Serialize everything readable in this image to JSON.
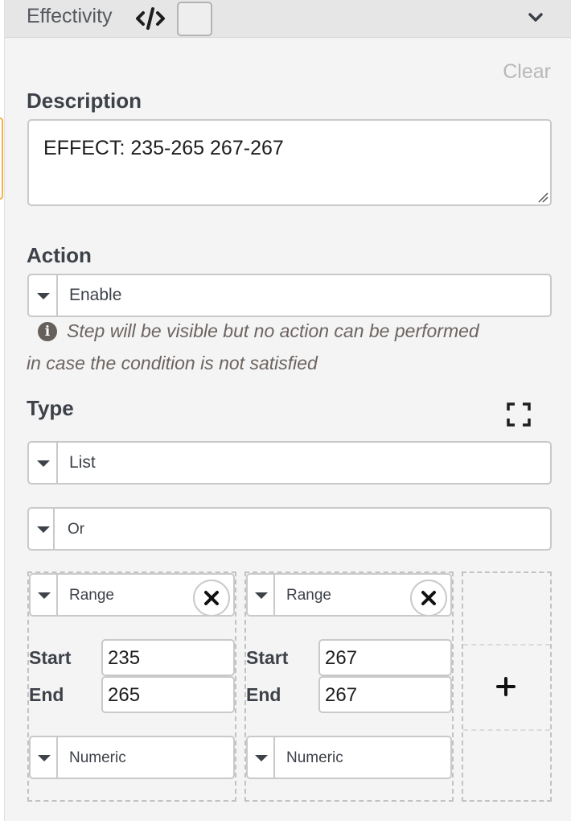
{
  "header": {
    "title": "Effectivity",
    "code_icon": "code-icon",
    "expand_icon": "chevron-down-icon"
  },
  "clear_label": "Clear",
  "description": {
    "label": "Description",
    "value": "EFFECT: 235-265 267-267"
  },
  "action": {
    "label": "Action",
    "selected": "Enable",
    "info_line1": "Step will be visible but no action can be performed",
    "info_line2": "in case the condition is not satisfied"
  },
  "type": {
    "label": "Type",
    "selected": "List",
    "operator": "Or"
  },
  "ranges": [
    {
      "type": "Range",
      "start_label": "Start",
      "start": "235",
      "end_label": "End",
      "end": "265",
      "format": "Numeric"
    },
    {
      "type": "Range",
      "start_label": "Start",
      "start": "267",
      "end_label": "End",
      "end": "267",
      "format": "Numeric"
    }
  ],
  "colors": {
    "accent_orange": "#f0b44a",
    "border": "#c9c9c9",
    "panel_bg": "#f4f4f4"
  }
}
